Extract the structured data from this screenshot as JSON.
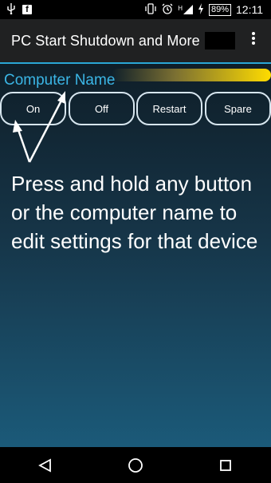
{
  "status_bar": {
    "time": "12:11",
    "battery_percent": "89%",
    "network_label": "H"
  },
  "app_bar": {
    "title": "PC Start Shutdown and More"
  },
  "device": {
    "computer_name": "Computer Name",
    "buttons": [
      {
        "label": "On"
      },
      {
        "label": "Off"
      },
      {
        "label": "Restart"
      },
      {
        "label": "Spare"
      }
    ]
  },
  "instructions": {
    "text": "Press and hold any button or the computer name to edit settings for that device"
  },
  "icons": {
    "usb": "usb-icon",
    "facebook": "facebook-icon",
    "vibrate": "vibrate-icon",
    "alarm": "alarm-icon",
    "signal": "signal-icon",
    "battery": "battery-charging-icon",
    "overflow": "overflow-menu-icon",
    "back": "back-icon",
    "home": "home-icon",
    "recents": "recents-icon"
  },
  "colors": {
    "accent": "#2aa7d6",
    "computer_name": "#3bb6e6",
    "glow": "#ffdc00"
  }
}
